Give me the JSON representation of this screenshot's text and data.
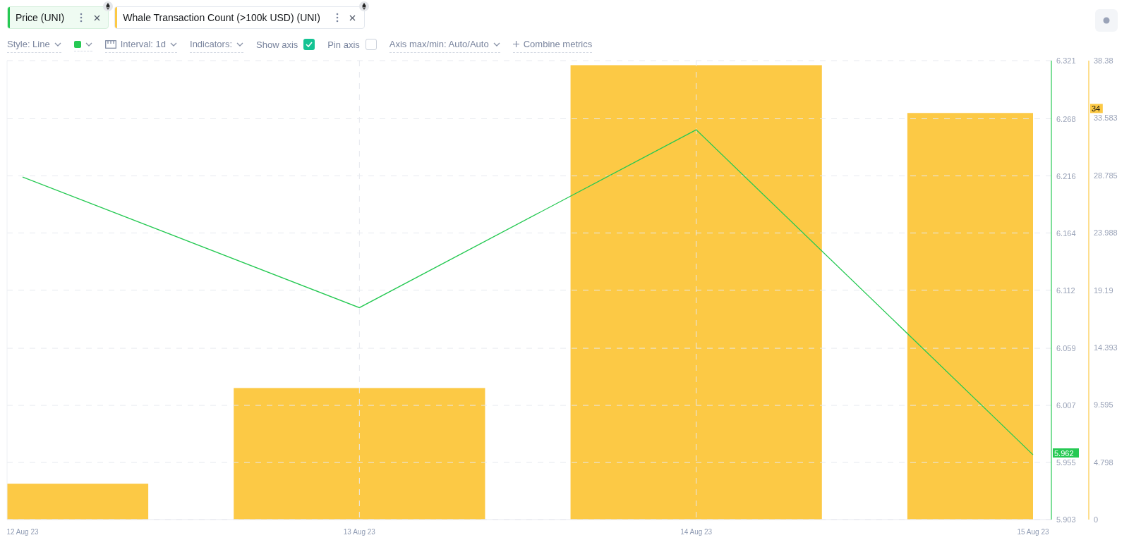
{
  "metrics": [
    {
      "label": "Price (UNI)",
      "color": "#26c953",
      "selected": true
    },
    {
      "label": "Whale Transaction Count (>100k USD) (UNI)",
      "color": "#fcc945",
      "selected": false
    }
  ],
  "toolbar": [
    {
      "kind": "dropdown",
      "label": "Style: Line"
    },
    {
      "kind": "color",
      "color": "#26c953"
    },
    {
      "kind": "interval",
      "label": "Interval: 1d"
    },
    {
      "kind": "dropdown",
      "label": "Indicators:"
    },
    {
      "kind": "checkbox",
      "label": "Show axis",
      "checked": true
    },
    {
      "kind": "checkbox",
      "label": "Pin axis",
      "checked": false
    },
    {
      "kind": "dropdown",
      "label": "Axis max/min: Auto/Auto"
    },
    {
      "kind": "add",
      "label": "Combine metrics"
    }
  ],
  "whale_chart": {
    "chart_data": {
      "type": "bar",
      "series": [
        {
          "color": "#fcc945",
          "values": [
            3,
            11,
            38,
            34
          ]
        }
      ],
      "ylim": [
        0,
        38.38
      ],
      "yticks": [
        0,
        4.798,
        9.595,
        14.393,
        19.19,
        23.988,
        28.785,
        33.583,
        38.38
      ],
      "annotations": [
        "34"
      ]
    }
  },
  "price_chart": {
    "chart_data": {
      "type": "line",
      "categories": [
        "12 Aug 23",
        "13 Aug 23",
        "14 Aug 23",
        "15 Aug 23"
      ],
      "series": [
        {
          "color": "#26c953",
          "values": [
            6.215,
            6.096,
            6.258,
            5.962
          ]
        }
      ],
      "ylim": [
        5.903,
        6.321
      ],
      "yticks": [
        5.903,
        5.955,
        6.007,
        6.059,
        6.112,
        6.164,
        6.216,
        6.268,
        6.321
      ],
      "grid": true,
      "annotations": [
        "5.962"
      ]
    }
  }
}
